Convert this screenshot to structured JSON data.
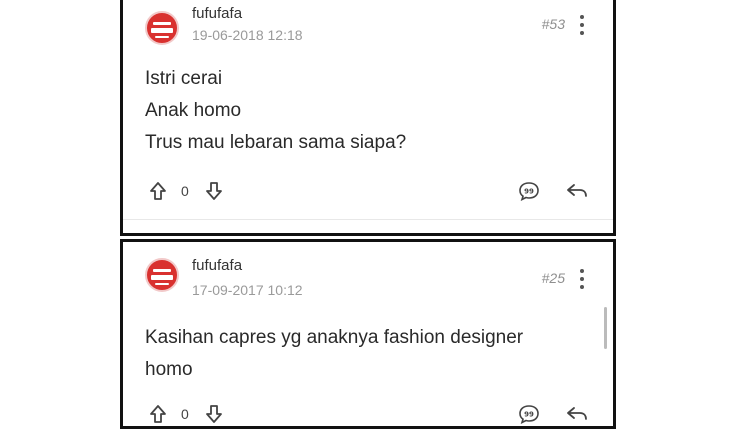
{
  "posts": [
    {
      "username": "fufufafa",
      "timestamp": "19-06-2018 12:18",
      "post_number": "#53",
      "content_lines": [
        "Istri cerai",
        "Anak homo",
        "Trus mau lebaran sama siapa?"
      ],
      "vote_count": "0",
      "icons": [
        "upvote-arrow-icon",
        "downvote-arrow-icon",
        "quote-icon",
        "reply-icon",
        "more-vertical-icon"
      ]
    },
    {
      "username": "fufufafa",
      "timestamp": "17-09-2017 10:12",
      "post_number": "#25",
      "content_lines": [
        "Kasihan capres yg anaknya fashion designer",
        "homo"
      ],
      "vote_count": "0",
      "icons": [
        "upvote-arrow-icon",
        "downvote-arrow-icon",
        "quote-icon",
        "reply-icon",
        "more-vertical-icon"
      ]
    }
  ],
  "colors": {
    "avatar": "#d9312f",
    "frame": "#111111",
    "muted_text": "#9a9a9a"
  }
}
